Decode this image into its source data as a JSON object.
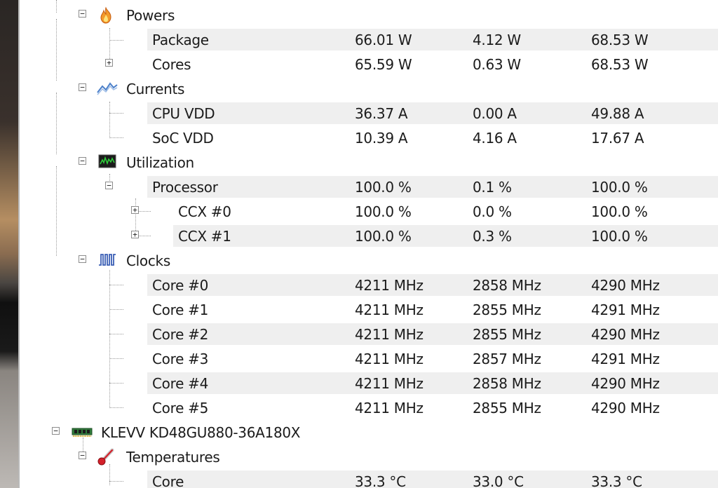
{
  "groups": {
    "powers": {
      "label": "Powers",
      "package": {
        "label": "Package",
        "current": "66.01 W",
        "min": "4.12 W",
        "max": "68.53 W"
      },
      "cores": {
        "label": "Cores",
        "current": "65.59 W",
        "min": "0.63 W",
        "max": "68.53 W"
      }
    },
    "currents": {
      "label": "Currents",
      "cpu_vdd": {
        "label": "CPU VDD",
        "current": "36.37 A",
        "min": "0.00 A",
        "max": "49.88 A"
      },
      "soc_vdd": {
        "label": "SoC VDD",
        "current": "10.39 A",
        "min": "4.16 A",
        "max": "17.67 A"
      }
    },
    "utilization": {
      "label": "Utilization",
      "processor": {
        "label": "Processor",
        "current": "100.0 %",
        "min": "0.1 %",
        "max": "100.0 %"
      },
      "ccx0": {
        "label": "CCX #0",
        "current": "100.0 %",
        "min": "0.0 %",
        "max": "100.0 %"
      },
      "ccx1": {
        "label": "CCX #1",
        "current": "100.0 %",
        "min": "0.3 %",
        "max": "100.0 %"
      }
    },
    "clocks": {
      "label": "Clocks",
      "core0": {
        "label": "Core #0",
        "current": "4211 MHz",
        "min": "2858 MHz",
        "max": "4290 MHz"
      },
      "core1": {
        "label": "Core #1",
        "current": "4211 MHz",
        "min": "2855 MHz",
        "max": "4291 MHz"
      },
      "core2": {
        "label": "Core #2",
        "current": "4211 MHz",
        "min": "2855 MHz",
        "max": "4290 MHz"
      },
      "core3": {
        "label": "Core #3",
        "current": "4211 MHz",
        "min": "2857 MHz",
        "max": "4291 MHz"
      },
      "core4": {
        "label": "Core #4",
        "current": "4211 MHz",
        "min": "2858 MHz",
        "max": "4290 MHz"
      },
      "core5": {
        "label": "Core #5",
        "current": "4211 MHz",
        "min": "2855 MHz",
        "max": "4290 MHz"
      }
    }
  },
  "memory": {
    "label": "KLEVV KD48GU880-36A180X",
    "temperatures": {
      "label": "Temperatures",
      "core": {
        "label": "Core",
        "current": "33.3 °C",
        "min": "33.0 °C",
        "max": "33.3 °C"
      }
    }
  },
  "icons": {
    "powers": "flame-icon",
    "currents": "current-wave-icon",
    "utilization": "utilization-monitor-icon",
    "clocks": "clock-pulse-icon",
    "memory": "ram-module-icon",
    "temperatures": "thermometer-icon"
  },
  "colors": {
    "row_band": "#efefef",
    "tree_line": "#9a9a9a"
  }
}
